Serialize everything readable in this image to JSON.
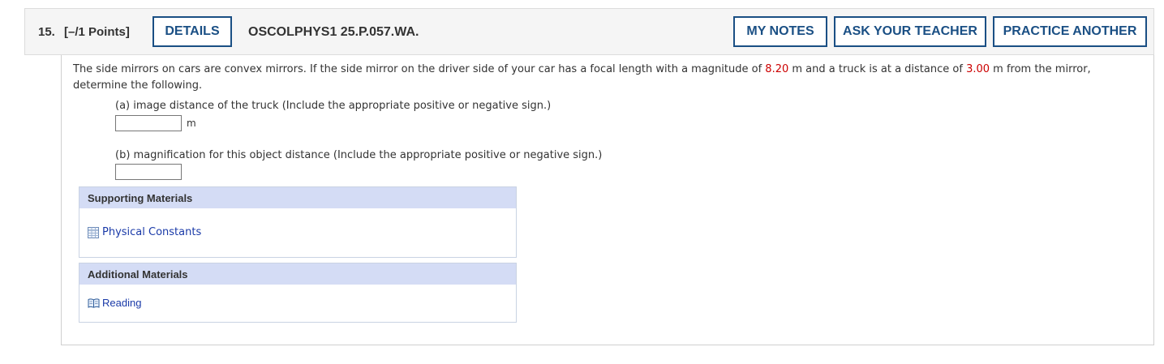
{
  "header": {
    "question_number": "15.",
    "points": "[–/1 Points]",
    "details_label": "DETAILS",
    "question_code": "OSCOLPHYS1 25.P.057.WA.",
    "my_notes_label": "MY NOTES",
    "ask_teacher_label": "ASK YOUR TEACHER",
    "practice_label": "PRACTICE ANOTHER"
  },
  "prompt": {
    "part1": "The side mirrors on cars are convex mirrors. If the side mirror on the driver side of your car has a focal length with a magnitude of ",
    "focal_length": "8.20",
    "part2": " m and a truck is at a distance of ",
    "distance": "3.00",
    "part3": " m from the mirror, determine the following."
  },
  "parts": {
    "a_label": "(a) image distance of the truck (Include the appropriate positive or negative sign.)",
    "a_value": "",
    "a_unit": "m",
    "b_label": "(b) magnification for this object distance (Include the appropriate positive or negative sign.)",
    "b_value": ""
  },
  "supporting": {
    "title": "Supporting Materials",
    "link": "Physical Constants"
  },
  "additional": {
    "title": "Additional Materials",
    "link": "Reading"
  },
  "colors": {
    "button_border": "#1a4f84",
    "highlight_red": "#cc0000",
    "panel_header": "#d4dcf5",
    "link": "#1a3aa8"
  },
  "icons": [
    "table-icon",
    "book-icon"
  ]
}
